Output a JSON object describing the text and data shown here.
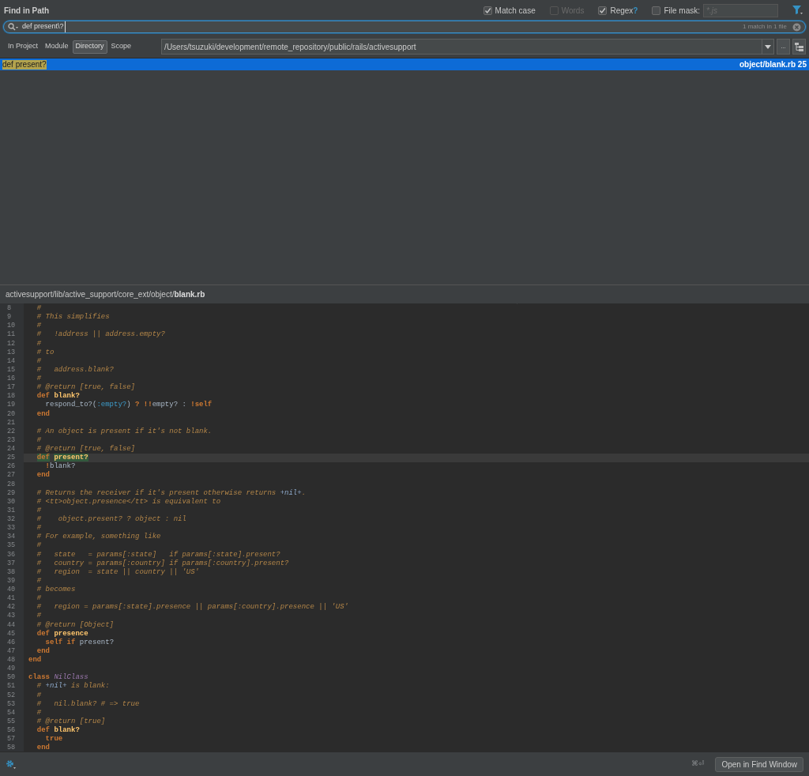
{
  "window": {
    "title": "Find in Path"
  },
  "options": [
    {
      "label": "Match case",
      "checked": true,
      "disabled": false
    },
    {
      "label": "Words",
      "checked": false,
      "disabled": true
    },
    {
      "label": "Regex",
      "checked": true,
      "disabled": false,
      "help": "?"
    },
    {
      "label": "File mask:",
      "checked": false,
      "disabled": false,
      "placeholder": "*.js"
    }
  ],
  "search": {
    "value": "def present\\?",
    "match_count": "1 match in 1 file"
  },
  "scope_tabs": [
    {
      "label": "In Project",
      "selected": false
    },
    {
      "label": "Module",
      "selected": false
    },
    {
      "label": "Directory",
      "selected": true
    },
    {
      "label": "Scope",
      "selected": false
    }
  ],
  "directory": {
    "value": "/Users/tsuzuki/development/remote_repository/public/rails/activesupport",
    "browse": "..."
  },
  "results": [
    {
      "match": "def present?",
      "file": "object/blank.rb 25",
      "selected": true
    }
  ],
  "preview": {
    "path_dir": "activesupport/lib/active_support/core_ext/object/",
    "path_file": "blank.rb",
    "lines": [
      {
        "number": "8",
        "current": false,
        "tokens": [
          {
            "kind": "cm",
            "text": "  #"
          }
        ]
      },
      {
        "number": "9",
        "current": false,
        "tokens": [
          {
            "kind": "cm",
            "text": "  # This simplifies"
          }
        ]
      },
      {
        "number": "10",
        "current": false,
        "tokens": [
          {
            "kind": "cm",
            "text": "  #"
          }
        ]
      },
      {
        "number": "11",
        "current": false,
        "tokens": [
          {
            "kind": "cm",
            "text": "  #   !address || address.empty?"
          }
        ]
      },
      {
        "number": "12",
        "current": false,
        "tokens": [
          {
            "kind": "cm",
            "text": "  #"
          }
        ]
      },
      {
        "number": "13",
        "current": false,
        "tokens": [
          {
            "kind": "cm",
            "text": "  # to"
          }
        ]
      },
      {
        "number": "14",
        "current": false,
        "tokens": [
          {
            "kind": "cm",
            "text": "  #"
          }
        ]
      },
      {
        "number": "15",
        "current": false,
        "tokens": [
          {
            "kind": "cm",
            "text": "  #   address.blank?"
          }
        ]
      },
      {
        "number": "16",
        "current": false,
        "tokens": [
          {
            "kind": "cm",
            "text": "  #"
          }
        ]
      },
      {
        "number": "17",
        "current": false,
        "tokens": [
          {
            "kind": "cm",
            "text": "  # @return [true, false]"
          }
        ]
      },
      {
        "number": "18",
        "current": false,
        "tokens": [
          {
            "kind": "kw",
            "text": "  def"
          },
          {
            "kind": "mn",
            "text": " blank?"
          }
        ]
      },
      {
        "number": "19",
        "current": false,
        "tokens": [
          {
            "kind": "pl",
            "text": "    respond_to?("
          },
          {
            "kind": "sym",
            "text": ":empty?"
          },
          {
            "kind": "pl",
            "text": ") "
          },
          {
            "kind": "op",
            "text": "? !!"
          },
          {
            "kind": "pl",
            "text": "empty? : "
          },
          {
            "kind": "op",
            "text": "!"
          },
          {
            "kind": "kw",
            "text": "self"
          }
        ]
      },
      {
        "number": "20",
        "current": false,
        "tokens": [
          {
            "kind": "kw",
            "text": "  end"
          }
        ]
      },
      {
        "number": "21",
        "current": false
      },
      {
        "number": "22",
        "current": false,
        "tokens": [
          {
            "kind": "cm",
            "text": "  # An object is present if it's not blank."
          }
        ]
      },
      {
        "number": "23",
        "current": false,
        "tokens": [
          {
            "kind": "cm",
            "text": "  #"
          }
        ]
      },
      {
        "number": "24",
        "current": false,
        "tokens": [
          {
            "kind": "cm",
            "text": "  # @return [true, false]"
          }
        ]
      },
      {
        "number": "25",
        "current": true,
        "tokens": [
          {
            "kind": "match-kw",
            "text": "  def"
          },
          {
            "kind": "match-mn",
            "text": " present?"
          }
        ]
      },
      {
        "number": "26",
        "current": false,
        "tokens": [
          {
            "kind": "op",
            "text": "    !"
          },
          {
            "kind": "pl",
            "text": "blank?"
          }
        ]
      },
      {
        "number": "27",
        "current": false,
        "tokens": [
          {
            "kind": "kw",
            "text": "  end"
          }
        ]
      },
      {
        "number": "28",
        "current": false
      },
      {
        "number": "29",
        "current": false,
        "tokens": [
          {
            "kind": "cm",
            "text": "  # Returns the receiver if it's present otherwise returns "
          },
          {
            "kind": "ref",
            "text": "+nil+"
          },
          {
            "kind": "cm",
            "text": "."
          }
        ]
      },
      {
        "number": "30",
        "current": false,
        "tokens": [
          {
            "kind": "cm",
            "text": "  # <tt>object.presence</tt> is equivalent to"
          }
        ]
      },
      {
        "number": "31",
        "current": false,
        "tokens": [
          {
            "kind": "cm",
            "text": "  #"
          }
        ]
      },
      {
        "number": "32",
        "current": false,
        "tokens": [
          {
            "kind": "cm",
            "text": "  #    object.present? ? object : nil"
          }
        ]
      },
      {
        "number": "33",
        "current": false,
        "tokens": [
          {
            "kind": "cm",
            "text": "  #"
          }
        ]
      },
      {
        "number": "34",
        "current": false,
        "tokens": [
          {
            "kind": "cm",
            "text": "  # For example, something like"
          }
        ]
      },
      {
        "number": "35",
        "current": false,
        "tokens": [
          {
            "kind": "cm",
            "text": "  #"
          }
        ]
      },
      {
        "number": "36",
        "current": false,
        "tokens": [
          {
            "kind": "cm",
            "text": "  #   state   = params[:state]   if params[:state].present?"
          }
        ]
      },
      {
        "number": "37",
        "current": false,
        "tokens": [
          {
            "kind": "cm",
            "text": "  #   country = params[:country] if params[:country].present?"
          }
        ]
      },
      {
        "number": "38",
        "current": false,
        "tokens": [
          {
            "kind": "cm",
            "text": "  #   region  = state || country || 'US'"
          }
        ]
      },
      {
        "number": "39",
        "current": false,
        "tokens": [
          {
            "kind": "cm",
            "text": "  #"
          }
        ]
      },
      {
        "number": "40",
        "current": false,
        "tokens": [
          {
            "kind": "cm",
            "text": "  # becomes"
          }
        ]
      },
      {
        "number": "41",
        "current": false,
        "tokens": [
          {
            "kind": "cm",
            "text": "  #"
          }
        ]
      },
      {
        "number": "42",
        "current": false,
        "tokens": [
          {
            "kind": "cm",
            "text": "  #   region = params[:state].presence || params[:country].presence || 'US'"
          }
        ]
      },
      {
        "number": "43",
        "current": false,
        "tokens": [
          {
            "kind": "cm",
            "text": "  #"
          }
        ]
      },
      {
        "number": "44",
        "current": false,
        "tokens": [
          {
            "kind": "cm",
            "text": "  # @return [Object]"
          }
        ]
      },
      {
        "number": "45",
        "current": false,
        "tokens": [
          {
            "kind": "kw",
            "text": "  def"
          },
          {
            "kind": "mn",
            "text": " presence"
          }
        ]
      },
      {
        "number": "46",
        "current": false,
        "tokens": [
          {
            "kind": "kw",
            "text": "    self if"
          },
          {
            "kind": "pl",
            "text": " present?"
          }
        ]
      },
      {
        "number": "47",
        "current": false,
        "tokens": [
          {
            "kind": "kw",
            "text": "  end"
          }
        ]
      },
      {
        "number": "48",
        "current": false,
        "tokens": [
          {
            "kind": "kw",
            "text": "end"
          }
        ]
      },
      {
        "number": "49",
        "current": false
      },
      {
        "number": "50",
        "current": false,
        "tokens": [
          {
            "kind": "kw",
            "text": "class"
          },
          {
            "kind": "const",
            "text": " NilClass"
          }
        ]
      },
      {
        "number": "51",
        "current": false,
        "tokens": [
          {
            "kind": "cm",
            "text": "  # "
          },
          {
            "kind": "ref",
            "text": "+nil+"
          },
          {
            "kind": "cm",
            "text": " is blank:"
          }
        ]
      },
      {
        "number": "52",
        "current": false,
        "tokens": [
          {
            "kind": "cm",
            "text": "  #"
          }
        ]
      },
      {
        "number": "53",
        "current": false,
        "tokens": [
          {
            "kind": "cm",
            "text": "  #   nil.blank? # => true"
          }
        ]
      },
      {
        "number": "54",
        "current": false,
        "tokens": [
          {
            "kind": "cm",
            "text": "  #"
          }
        ]
      },
      {
        "number": "55",
        "current": false,
        "tokens": [
          {
            "kind": "cm",
            "text": "  # @return [true]"
          }
        ]
      },
      {
        "number": "56",
        "current": false,
        "tokens": [
          {
            "kind": "kw",
            "text": "  def"
          },
          {
            "kind": "mn",
            "text": " blank?"
          }
        ]
      },
      {
        "number": "57",
        "current": false,
        "tokens": [
          {
            "kind": "kw",
            "text": "    true"
          }
        ]
      },
      {
        "number": "58",
        "current": false,
        "tokens": [
          {
            "kind": "kw",
            "text": "  end"
          }
        ]
      }
    ]
  },
  "footer": {
    "shortcut": "⌘⏎",
    "button": "Open in Find Window"
  }
}
